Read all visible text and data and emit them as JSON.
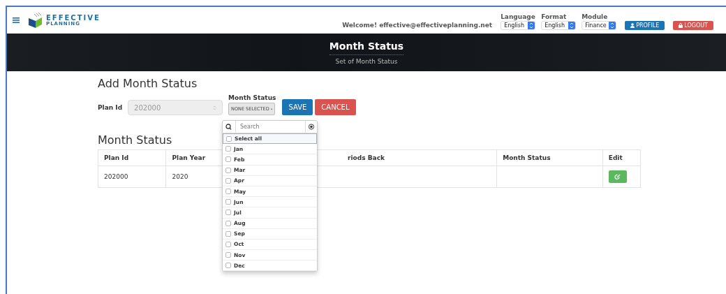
{
  "header": {
    "logo": {
      "name": "EFFECTIVE",
      "tagline": "PLANNING"
    },
    "welcome": "Welcome! effective@effectiveplanning.net",
    "selects": [
      {
        "label": "Language",
        "value": "English"
      },
      {
        "label": "Format",
        "value": "English"
      },
      {
        "label": "Module",
        "value": "Finance"
      }
    ],
    "buttons": [
      {
        "label": "PROFILE",
        "kind": "profile"
      },
      {
        "label": "LOGOUT",
        "kind": "logout"
      }
    ]
  },
  "banner": {
    "title": "Month Status",
    "subtitle": "Set of Month Status"
  },
  "form": {
    "title": "Add Month Status",
    "plan_id": {
      "label": "Plan Id",
      "value": "202000",
      "disabled": true
    },
    "month_status": {
      "label": "Month Status",
      "button": "NONE SELECTED"
    },
    "buttons": [
      {
        "label": "SAVE",
        "kind": "primary"
      },
      {
        "label": "CANCEL",
        "kind": "danger"
      }
    ]
  },
  "dropdown": {
    "search_placeholder": "Search",
    "items": [
      {
        "label": "Select all",
        "checked": false,
        "focused": true
      },
      {
        "label": "Jan",
        "checked": false,
        "focused": false
      },
      {
        "label": "Feb",
        "checked": false,
        "focused": false
      },
      {
        "label": "Mar",
        "checked": false,
        "focused": false
      },
      {
        "label": "Apr",
        "checked": false,
        "focused": false
      },
      {
        "label": "May",
        "checked": false,
        "focused": false
      },
      {
        "label": "Jun",
        "checked": false,
        "focused": false
      },
      {
        "label": "Jul",
        "checked": false,
        "focused": false
      },
      {
        "label": "Aug",
        "checked": false,
        "focused": false
      },
      {
        "label": "Sep",
        "checked": false,
        "focused": false
      },
      {
        "label": "Oct",
        "checked": false,
        "focused": false
      },
      {
        "label": "Nov",
        "checked": false,
        "focused": false
      },
      {
        "label": "Dec",
        "checked": false,
        "focused": false
      }
    ]
  },
  "table": {
    "title": "Month Status",
    "columns": [
      "Plan Id",
      "Plan Year",
      "riods Back",
      "Month Status",
      "Edit"
    ],
    "rows": [
      {
        "cells": [
          "202000",
          "2020",
          "",
          ""
        ]
      }
    ]
  }
}
